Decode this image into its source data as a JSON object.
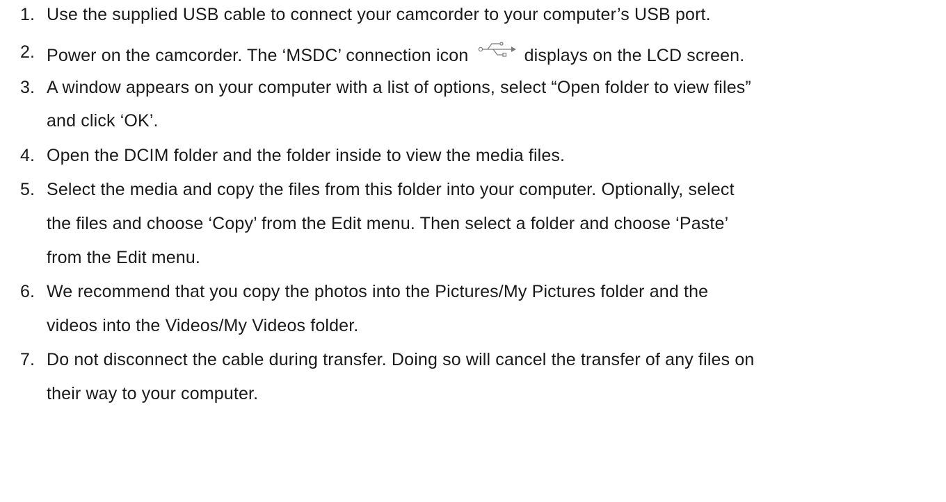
{
  "steps": [
    {
      "num": "1.",
      "lines": [
        "Use the supplied USB cable to connect your camcorder to your computer’s USB port."
      ]
    },
    {
      "num": "2.",
      "before_icon": "Power on the camcorder. The ‘MSDC’ connection icon",
      "icon": "usb-icon",
      "after_icon": "displays on the LCD screen."
    },
    {
      "num": "3.",
      "lines": [
        "A window appears on your computer with a list of options, select “Open folder to view files”",
        "and click ‘OK’."
      ]
    },
    {
      "num": "4.",
      "lines": [
        "Open the DCIM folder and the folder inside to view the media files."
      ]
    },
    {
      "num": "5.",
      "lines": [
        "Select the media and copy the files from this folder into your computer. Optionally, select",
        "the files and choose ‘Copy’ from the Edit menu. Then select a folder and choose ‘Paste’",
        "from the Edit menu."
      ]
    },
    {
      "num": "6.",
      "lines": [
        "We recommend that you copy the photos into the Pictures/My Pictures folder and the",
        "videos into the Videos/My Videos folder."
      ]
    },
    {
      "num": "7.",
      "lines": [
        "Do not disconnect the cable during transfer. Doing so will cancel the transfer of any files on",
        "their way to your computer."
      ]
    }
  ]
}
